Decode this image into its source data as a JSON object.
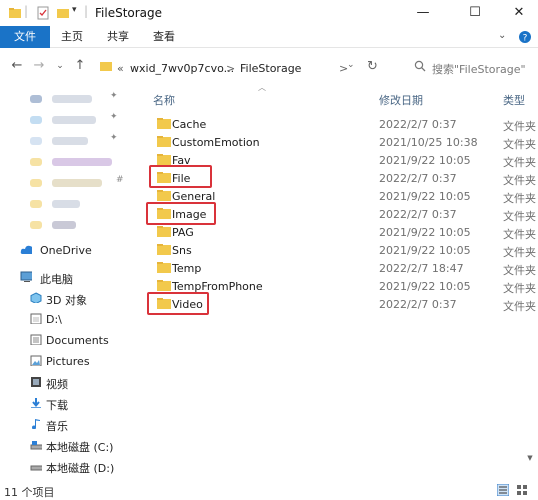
{
  "window": {
    "title": "FileStorage",
    "controls": [
      "—",
      "☐",
      "✕"
    ]
  },
  "ribbon": {
    "tabs": [
      "文件",
      "主页",
      "共享",
      "查看"
    ]
  },
  "address": {
    "crumbs": [
      "«",
      "wxid_7wv0p7cvo...",
      ">",
      "FileStorage",
      ">"
    ],
    "search_placeholder": "搜索\"FileStorage\""
  },
  "sidebar": {
    "items": [
      {
        "label": "OneDrive",
        "icon": "cloud-icon"
      },
      {
        "label": "此电脑",
        "icon": "computer-icon"
      },
      {
        "label": "3D 对象",
        "icon": "cube-icon"
      },
      {
        "label": "D:\\",
        "icon": "folder-icon"
      },
      {
        "label": "Documents",
        "icon": "document-icon"
      },
      {
        "label": "Pictures",
        "icon": "picture-icon"
      },
      {
        "label": "视频",
        "icon": "video-icon"
      },
      {
        "label": "下载",
        "icon": "download-icon"
      },
      {
        "label": "音乐",
        "icon": "music-icon"
      },
      {
        "label": "本地磁盘 (C:)",
        "icon": "drive-icon"
      },
      {
        "label": "本地磁盘 (D:)",
        "icon": "drive-icon"
      }
    ]
  },
  "columns": {
    "name": "名称",
    "modified": "修改日期",
    "type": "类型"
  },
  "files": [
    {
      "name": "Cache",
      "date": "2022/2/7 0:37",
      "type": "文件夹"
    },
    {
      "name": "CustomEmotion",
      "date": "2021/10/25 10:38",
      "type": "文件夹"
    },
    {
      "name": "Fav",
      "date": "2021/9/22 10:05",
      "type": "文件夹"
    },
    {
      "name": "File",
      "date": "2022/2/7 0:37",
      "type": "文件夹"
    },
    {
      "name": "General",
      "date": "2021/9/22 10:05",
      "type": "文件夹"
    },
    {
      "name": "Image",
      "date": "2022/2/7 0:37",
      "type": "文件夹"
    },
    {
      "name": "PAG",
      "date": "2021/9/22 10:05",
      "type": "文件夹"
    },
    {
      "name": "Sns",
      "date": "2021/9/22 10:05",
      "type": "文件夹"
    },
    {
      "name": "Temp",
      "date": "2022/2/7 18:47",
      "type": "文件夹"
    },
    {
      "name": "TempFromPhone",
      "date": "2021/9/22 10:05",
      "type": "文件夹"
    },
    {
      "name": "Video",
      "date": "2022/2/7 0:37",
      "type": "文件夹"
    }
  ],
  "status": {
    "count": "11 个项目"
  },
  "colors": {
    "accent": "#1a73c7",
    "highlight": "#d9323a",
    "folder": "#f2c94c"
  }
}
